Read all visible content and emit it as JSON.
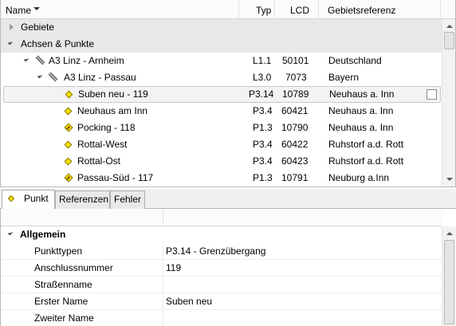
{
  "tree": {
    "columns": [
      {
        "key": "name",
        "label": "Name"
      },
      {
        "key": "typ",
        "label": "Typ"
      },
      {
        "key": "lcd",
        "label": "LCD"
      },
      {
        "key": "ref",
        "label": "Gebietsreferenz"
      }
    ],
    "rows": [
      {
        "name": "Gebiete",
        "typ": "",
        "lcd": "",
        "ref": ""
      },
      {
        "name": "Achsen & Punkte",
        "typ": "",
        "lcd": "",
        "ref": ""
      },
      {
        "name": "A3 Linz - Arnheim",
        "typ": "L1.1",
        "lcd": "50101",
        "ref": "Deutschland"
      },
      {
        "name": "A3 Linz - Passau",
        "typ": "L3.0",
        "lcd": "7073",
        "ref": "Bayern"
      },
      {
        "name": "Suben neu - 119",
        "typ": "P3.14",
        "lcd": "10789",
        "ref": "Neuhaus a. Inn"
      },
      {
        "name": "Neuhaus am Inn",
        "typ": "P3.4",
        "lcd": "60421",
        "ref": "Neuhaus a. Inn"
      },
      {
        "name": "Pocking - 118",
        "typ": "P1.3",
        "lcd": "10790",
        "ref": "Neuhaus a. Inn"
      },
      {
        "name": "Rottal-West",
        "typ": "P3.4",
        "lcd": "60422",
        "ref": "Ruhstorf a.d. Rott"
      },
      {
        "name": "Rottal-Ost",
        "typ": "P3.4",
        "lcd": "60423",
        "ref": "Ruhstorf a.d. Rott"
      },
      {
        "name": "Passau-Süd - 117",
        "typ": "P1.3",
        "lcd": "10791",
        "ref": "Neuburg a.Inn"
      }
    ]
  },
  "tabs": [
    {
      "label": "Punkt"
    },
    {
      "label": "Referenzen"
    },
    {
      "label": "Fehler"
    }
  ],
  "properties": {
    "group": "Allgemein",
    "rows": [
      {
        "label": "Punkttypen",
        "value": "P3.14 - Grenzübergang"
      },
      {
        "label": "Anschlussnummer",
        "value": "119"
      },
      {
        "label": "Straßenname",
        "value": ""
      },
      {
        "label": "Erster Name",
        "value": "Suben neu"
      },
      {
        "label": "Zweiter Name",
        "value": ""
      }
    ]
  }
}
